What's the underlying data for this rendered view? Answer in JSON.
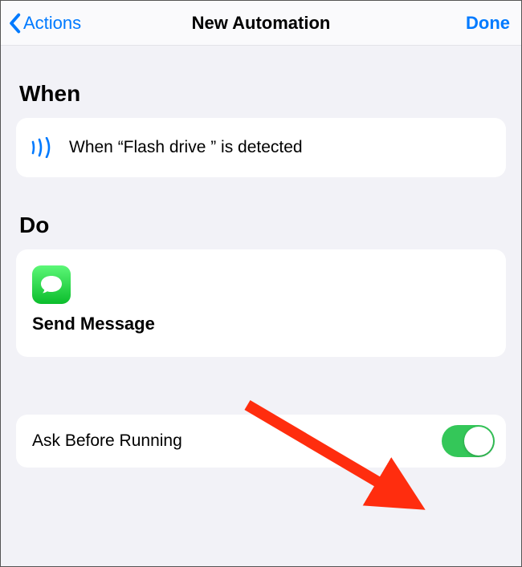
{
  "navbar": {
    "back_label": "Actions",
    "title": "New Automation",
    "done_label": "Done"
  },
  "sections": {
    "when_header": "When",
    "do_header": "Do"
  },
  "when": {
    "trigger_text": "When “Flash drive ” is detected"
  },
  "do": {
    "action_name": "Send Message"
  },
  "settings": {
    "ask_before_running_label": "Ask Before Running",
    "ask_before_running_on": true
  },
  "colors": {
    "tint": "#007aff",
    "toggle_on": "#34c759"
  }
}
